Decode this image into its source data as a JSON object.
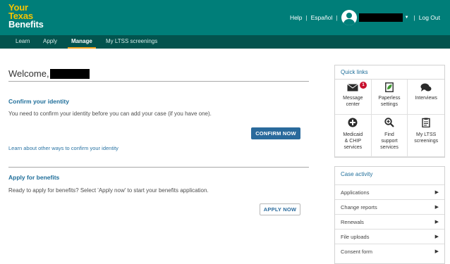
{
  "header": {
    "logo": {
      "line1": "Your",
      "line2": "Texas",
      "line3": "Benefits"
    },
    "help": "Help",
    "language": "Español",
    "separator": "|",
    "logout": "Log Out",
    "colors": {
      "bar": "#007e79",
      "logo_accent": "#f5c400"
    }
  },
  "nav": {
    "items": [
      {
        "label": "Learn"
      },
      {
        "label": "Apply"
      },
      {
        "label": "Manage"
      },
      {
        "label": "My LTSS screenings"
      }
    ],
    "active": "Manage",
    "colors": {
      "bar": "#03534e",
      "active_underline": "#f0a21f"
    }
  },
  "main": {
    "welcome": "Welcome,",
    "confirm": {
      "title": "Confirm your identity",
      "text": "You need to confirm your identity before you can add your case (if you have one).",
      "button": "CONFIRM NOW",
      "link": "Learn about other ways to confirm your identity"
    },
    "apply": {
      "title": "Apply for benefits",
      "text": "Ready to apply for benefits? Select 'Apply now' to start your benefits application.",
      "button": "APPLY NOW"
    }
  },
  "quick_links": {
    "title": "Quick links",
    "items": [
      {
        "icon": "envelope-icon",
        "label1": "Message",
        "label2": "center",
        "badge": "1"
      },
      {
        "icon": "document-leaf-icon",
        "label1": "Paperless",
        "label2": "settings"
      },
      {
        "icon": "chat-bubbles-icon",
        "label1": "Interviews",
        "label2": ""
      },
      {
        "icon": "plus-circle-icon",
        "label1": "Medicaid",
        "label2": "& CHIP",
        "label3": "services"
      },
      {
        "icon": "magnifier-icon",
        "label1": "Find",
        "label2": "support",
        "label3": "services"
      },
      {
        "icon": "clipboard-icon",
        "label1": "My LTSS",
        "label2": "screenings",
        "label3": ""
      }
    ]
  },
  "case_activity": {
    "title": "Case activity",
    "items": [
      {
        "label": "Applications"
      },
      {
        "label": "Change reports"
      },
      {
        "label": "Renewals"
      },
      {
        "label": "File uploads"
      },
      {
        "label": "Consent form"
      }
    ]
  }
}
